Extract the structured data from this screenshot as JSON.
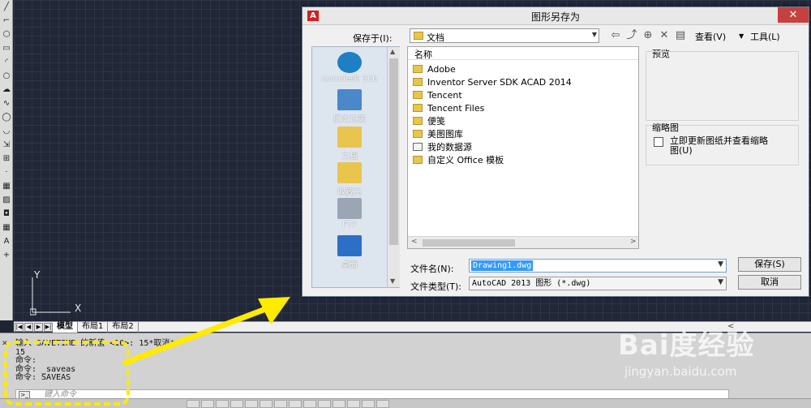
{
  "cad": {
    "left_toolbar_icons": [
      "line-icon",
      "polyline-icon",
      "polygon-icon",
      "rectangle-icon",
      "arc-icon",
      "circle-icon",
      "revcloud-icon",
      "spline-icon",
      "ellipse-icon",
      "ellipse-arc-icon",
      "insert-block-icon",
      "make-block-icon",
      "point-icon",
      "hatch-icon",
      "gradient-icon",
      "region-icon",
      "table-icon",
      "mtext-icon",
      "add-selected-icon"
    ],
    "ucs": {
      "x_label": "X",
      "y_label": "Y"
    },
    "layout_tabs": [
      "模型",
      "布局1",
      "布局2"
    ],
    "active_tab": "模型",
    "command_lines": [
      "输入 SAVETIME 的新值 <10>: 15*取消*",
      "15",
      "命令:",
      "命令: _saveas",
      "命令: SAVEAS"
    ],
    "command_placeholder": "键入命令"
  },
  "dialog": {
    "title": "图形另存为",
    "logo": "A",
    "save_in_label": "保存于(I):",
    "save_in_value": "文档",
    "toolbar": {
      "icons": [
        "back-icon",
        "up-folder-icon",
        "search-web-icon",
        "delete-icon",
        "new-folder-icon"
      ],
      "view_menu": "查看(V)",
      "tools_menu": "工具(L)"
    },
    "places": [
      {
        "label": "Autodesk 360",
        "icon": "autodesk-360-icon",
        "color": "#1f7fc4"
      },
      {
        "label": "历史记录",
        "icon": "history-icon",
        "color": "#4a88c9"
      },
      {
        "label": "文档",
        "icon": "documents-icon",
        "color": "#e9c54d"
      },
      {
        "label": "收藏夹",
        "icon": "favorites-icon",
        "color": "#e9c54d"
      },
      {
        "label": "FTP",
        "icon": "ftp-icon",
        "color": "#9aa6b4"
      },
      {
        "label": "桌面",
        "icon": "desktop-icon",
        "color": "#2d6fc6"
      }
    ],
    "list_header": "名称",
    "files": [
      {
        "name": "Adobe",
        "special": false
      },
      {
        "name": "Inventor Server SDK ACAD 2014",
        "special": false
      },
      {
        "name": "Tencent",
        "special": false
      },
      {
        "name": "Tencent Files",
        "special": false
      },
      {
        "name": "便笺",
        "special": false
      },
      {
        "name": "美图图库",
        "special": false
      },
      {
        "name": "我的数据源",
        "special": true
      },
      {
        "name": "自定义 Office 模板",
        "special": false
      }
    ],
    "preview_label": "预览",
    "thumbnail_label": "缩略图",
    "thumbnail_option": "立即更新图纸并查看缩略图(U)",
    "file_name_label": "文件名(N):",
    "file_name_value": "Drawing1.dwg",
    "file_type_label": "文件类型(T):",
    "file_type_value": "AutoCAD 2013 图形 (*.dwg)",
    "save_button": "保存(S)",
    "cancel_button": "取消"
  },
  "watermark": {
    "logo": "Bai度经验",
    "url": "jingyan.baidu.com"
  },
  "colors": {
    "highlight": "#ffea00",
    "selection": "#3399ff",
    "cad_background": "#212736"
  }
}
